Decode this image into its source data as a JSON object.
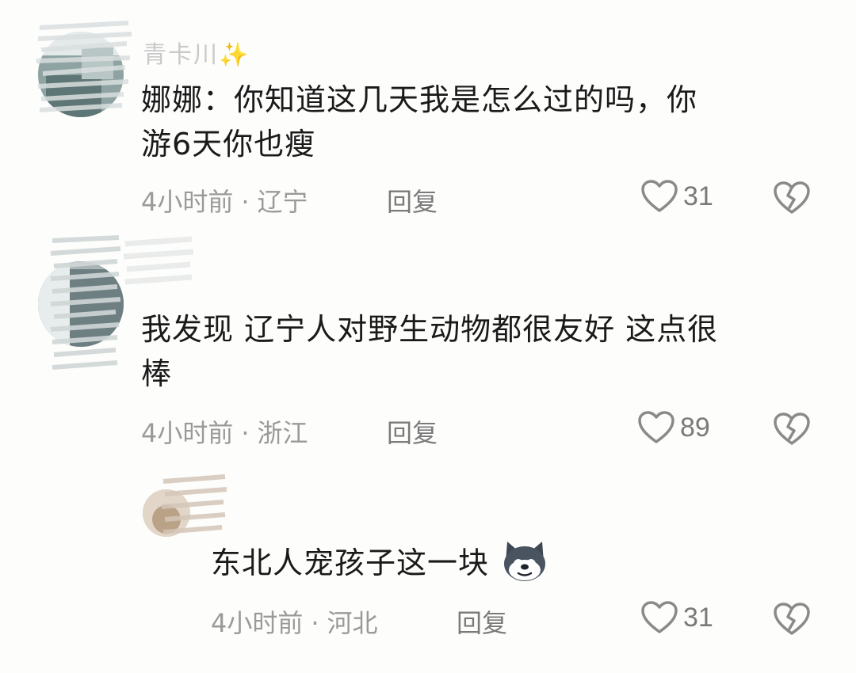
{
  "comments": [
    {
      "username": "青卡川✨",
      "text_line1": "娜娜：你知道这几天我是怎么过的吗，你",
      "text_line2": "游6天你也瘦",
      "time": "4小时前",
      "location": "辽宁",
      "reply_label": "回复",
      "likes": "31"
    },
    {
      "username": "",
      "text_line1": "我发现 辽宁人对野生动物都很友好 这点很",
      "text_line2": "棒",
      "time": "4小时前",
      "location": "浙江",
      "reply_label": "回复",
      "likes": "89"
    },
    {
      "username": "",
      "text_line1": "东北人宠孩子这一块",
      "emoji": "husky-emoji",
      "time": "4小时前",
      "location": "河北",
      "reply_label": "回复",
      "likes": "31"
    }
  ],
  "separator": "·",
  "icons": {
    "like": "heart-outline-icon",
    "dislike": "broken-heart-icon"
  },
  "colors": {
    "background": "#fdfdfc",
    "text": "#1a1a1a",
    "meta": "#9a9a9a",
    "icon": "#8a8a8a"
  }
}
